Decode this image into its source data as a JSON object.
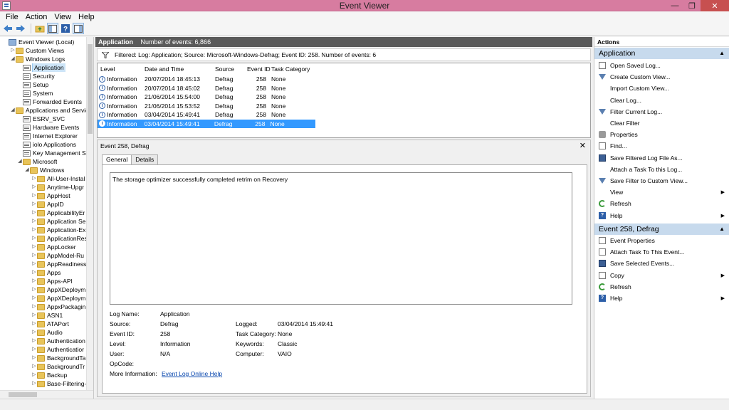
{
  "window": {
    "title": "Event Viewer"
  },
  "menu": [
    "File",
    "Action",
    "View",
    "Help"
  ],
  "toolbar": [
    "back-icon",
    "forward-icon",
    "folder-up-icon",
    "show-hide-tree-icon",
    "help-icon",
    "show-hide-action-pane-icon"
  ],
  "tree": {
    "items": [
      {
        "label": "Event Viewer (Local)",
        "depth": 0,
        "icon": "comp",
        "tw": ""
      },
      {
        "label": "Custom Views",
        "depth": 1,
        "icon": "folder",
        "tw": "▷"
      },
      {
        "label": "Windows Logs",
        "depth": 1,
        "icon": "folder",
        "tw": "◢"
      },
      {
        "label": "Application",
        "depth": 2,
        "icon": "log",
        "tw": "",
        "selected": true
      },
      {
        "label": "Security",
        "depth": 2,
        "icon": "log",
        "tw": ""
      },
      {
        "label": "Setup",
        "depth": 2,
        "icon": "log",
        "tw": ""
      },
      {
        "label": "System",
        "depth": 2,
        "icon": "log",
        "tw": ""
      },
      {
        "label": "Forwarded Events",
        "depth": 2,
        "icon": "log",
        "tw": ""
      },
      {
        "label": "Applications and Services Lo",
        "depth": 1,
        "icon": "folder",
        "tw": "◢"
      },
      {
        "label": "ESRV_SVC",
        "depth": 2,
        "icon": "log",
        "tw": ""
      },
      {
        "label": "Hardware Events",
        "depth": 2,
        "icon": "log",
        "tw": ""
      },
      {
        "label": "Internet Explorer",
        "depth": 2,
        "icon": "log",
        "tw": ""
      },
      {
        "label": "iolo Applications",
        "depth": 2,
        "icon": "log",
        "tw": ""
      },
      {
        "label": "Key Management Ser",
        "depth": 2,
        "icon": "log",
        "tw": ""
      },
      {
        "label": "Microsoft",
        "depth": 2,
        "icon": "folder",
        "tw": "◢"
      },
      {
        "label": "Windows",
        "depth": 3,
        "icon": "folder",
        "tw": "◢"
      },
      {
        "label": "All-User-Instal",
        "depth": 4,
        "icon": "folder",
        "tw": "▷"
      },
      {
        "label": "Anytime-Upgr",
        "depth": 4,
        "icon": "folder",
        "tw": "▷"
      },
      {
        "label": "AppHost",
        "depth": 4,
        "icon": "folder",
        "tw": "▷"
      },
      {
        "label": "AppID",
        "depth": 4,
        "icon": "folder",
        "tw": "▷"
      },
      {
        "label": "ApplicabilityEr",
        "depth": 4,
        "icon": "folder",
        "tw": "▷"
      },
      {
        "label": "Application Se",
        "depth": 4,
        "icon": "folder",
        "tw": "▷"
      },
      {
        "label": "Application-Ex",
        "depth": 4,
        "icon": "folder",
        "tw": "▷"
      },
      {
        "label": "ApplicationRes",
        "depth": 4,
        "icon": "folder",
        "tw": "▷"
      },
      {
        "label": "AppLocker",
        "depth": 4,
        "icon": "folder",
        "tw": "▷"
      },
      {
        "label": "AppModel-Ru",
        "depth": 4,
        "icon": "folder",
        "tw": "▷"
      },
      {
        "label": "AppReadiness",
        "depth": 4,
        "icon": "folder",
        "tw": "▷"
      },
      {
        "label": "Apps",
        "depth": 4,
        "icon": "folder",
        "tw": "▷"
      },
      {
        "label": "Apps-API",
        "depth": 4,
        "icon": "folder",
        "tw": "▷"
      },
      {
        "label": "AppXDeploym",
        "depth": 4,
        "icon": "folder",
        "tw": "▷"
      },
      {
        "label": "AppXDeploym",
        "depth": 4,
        "icon": "folder",
        "tw": "▷"
      },
      {
        "label": "AppxPackagin",
        "depth": 4,
        "icon": "folder",
        "tw": "▷"
      },
      {
        "label": "ASN1",
        "depth": 4,
        "icon": "folder",
        "tw": "▷"
      },
      {
        "label": "ATAPort",
        "depth": 4,
        "icon": "folder",
        "tw": "▷"
      },
      {
        "label": "Audio",
        "depth": 4,
        "icon": "folder",
        "tw": "▷"
      },
      {
        "label": "Authentication",
        "depth": 4,
        "icon": "folder",
        "tw": "▷"
      },
      {
        "label": "Authenticatior",
        "depth": 4,
        "icon": "folder",
        "tw": "▷"
      },
      {
        "label": "BackgroundTa",
        "depth": 4,
        "icon": "folder",
        "tw": "▷"
      },
      {
        "label": "BackgroundTr",
        "depth": 4,
        "icon": "folder",
        "tw": "▷"
      },
      {
        "label": "Backup",
        "depth": 4,
        "icon": "folder",
        "tw": "▷"
      },
      {
        "label": "Base-Filtering-",
        "depth": 4,
        "icon": "folder",
        "tw": "▷"
      }
    ]
  },
  "center": {
    "header_name": "Application",
    "header_count": "Number of events: 6,866",
    "filter_text": "Filtered: Log: Application; Source: Microsoft-Windows-Defrag; Event ID: 258. Number of events: 6",
    "columns": [
      "Level",
      "Date and Time",
      "Source",
      "Event ID",
      "Task Category"
    ],
    "rows": [
      {
        "level": "Information",
        "date": "20/07/2014 18:45:13",
        "source": "Defrag",
        "id": "258",
        "cat": "None"
      },
      {
        "level": "Information",
        "date": "20/07/2014 18:45:02",
        "source": "Defrag",
        "id": "258",
        "cat": "None"
      },
      {
        "level": "Information",
        "date": "21/06/2014 15:54:00",
        "source": "Defrag",
        "id": "258",
        "cat": "None"
      },
      {
        "level": "Information",
        "date": "21/06/2014 15:53:52",
        "source": "Defrag",
        "id": "258",
        "cat": "None"
      },
      {
        "level": "Information",
        "date": "03/04/2014 15:49:41",
        "source": "Defrag",
        "id": "258",
        "cat": "None"
      },
      {
        "level": "Information",
        "date": "03/04/2014 15:49:41",
        "source": "Defrag",
        "id": "258",
        "cat": "None",
        "selected": true
      }
    ]
  },
  "detail": {
    "title": "Event 258, Defrag",
    "close": "✕",
    "tabs": {
      "general": "General",
      "details": "Details"
    },
    "message": "The storage optimizer successfully completed retrim on Recovery",
    "fields": {
      "log_name_k": "Log Name:",
      "log_name_v": "Application",
      "source_k": "Source:",
      "source_v": "Defrag",
      "logged_k": "Logged:",
      "logged_v": "03/04/2014 15:49:41",
      "event_id_k": "Event ID:",
      "event_id_v": "258",
      "task_cat_k": "Task Category:",
      "task_cat_v": "None",
      "level_k": "Level:",
      "level_v": "Information",
      "keywords_k": "Keywords:",
      "keywords_v": "Classic",
      "user_k": "User:",
      "user_v": "N/A",
      "computer_k": "Computer:",
      "computer_v": "VAIO",
      "opcode_k": "OpCode:",
      "opcode_v": "",
      "more_k": "More Information:",
      "more_v": "Event Log Online Help"
    }
  },
  "actions": {
    "header": "Actions",
    "group1": "Application",
    "group1_items": [
      {
        "label": "Open Saved Log...",
        "icon": "doc"
      },
      {
        "label": "Create Custom View...",
        "icon": "funnel"
      },
      {
        "label": "Import Custom View...",
        "icon": "none"
      },
      {
        "label": "Clear Log...",
        "icon": "none"
      },
      {
        "label": "Filter Current Log...",
        "icon": "funnel"
      },
      {
        "label": "Clear Filter",
        "icon": "none"
      },
      {
        "label": "Properties",
        "icon": "gear"
      },
      {
        "label": "Find...",
        "icon": "doc"
      },
      {
        "label": "Save Filtered Log File As...",
        "icon": "disk"
      },
      {
        "label": "Attach a Task To this Log...",
        "icon": "none"
      },
      {
        "label": "Save Filter to Custom View...",
        "icon": "funnel"
      },
      {
        "label": "View",
        "icon": "none",
        "sub": true
      },
      {
        "label": "Refresh",
        "icon": "refresh"
      },
      {
        "label": "Help",
        "icon": "help",
        "sub": true
      }
    ],
    "group2": "Event 258, Defrag",
    "group2_items": [
      {
        "label": "Event Properties",
        "icon": "doc"
      },
      {
        "label": "Attach Task To This Event...",
        "icon": "doc"
      },
      {
        "label": "Save Selected Events...",
        "icon": "disk"
      },
      {
        "label": "Copy",
        "icon": "doc",
        "sub": true
      },
      {
        "label": "Refresh",
        "icon": "refresh"
      },
      {
        "label": "Help",
        "icon": "help",
        "sub": true
      }
    ]
  }
}
